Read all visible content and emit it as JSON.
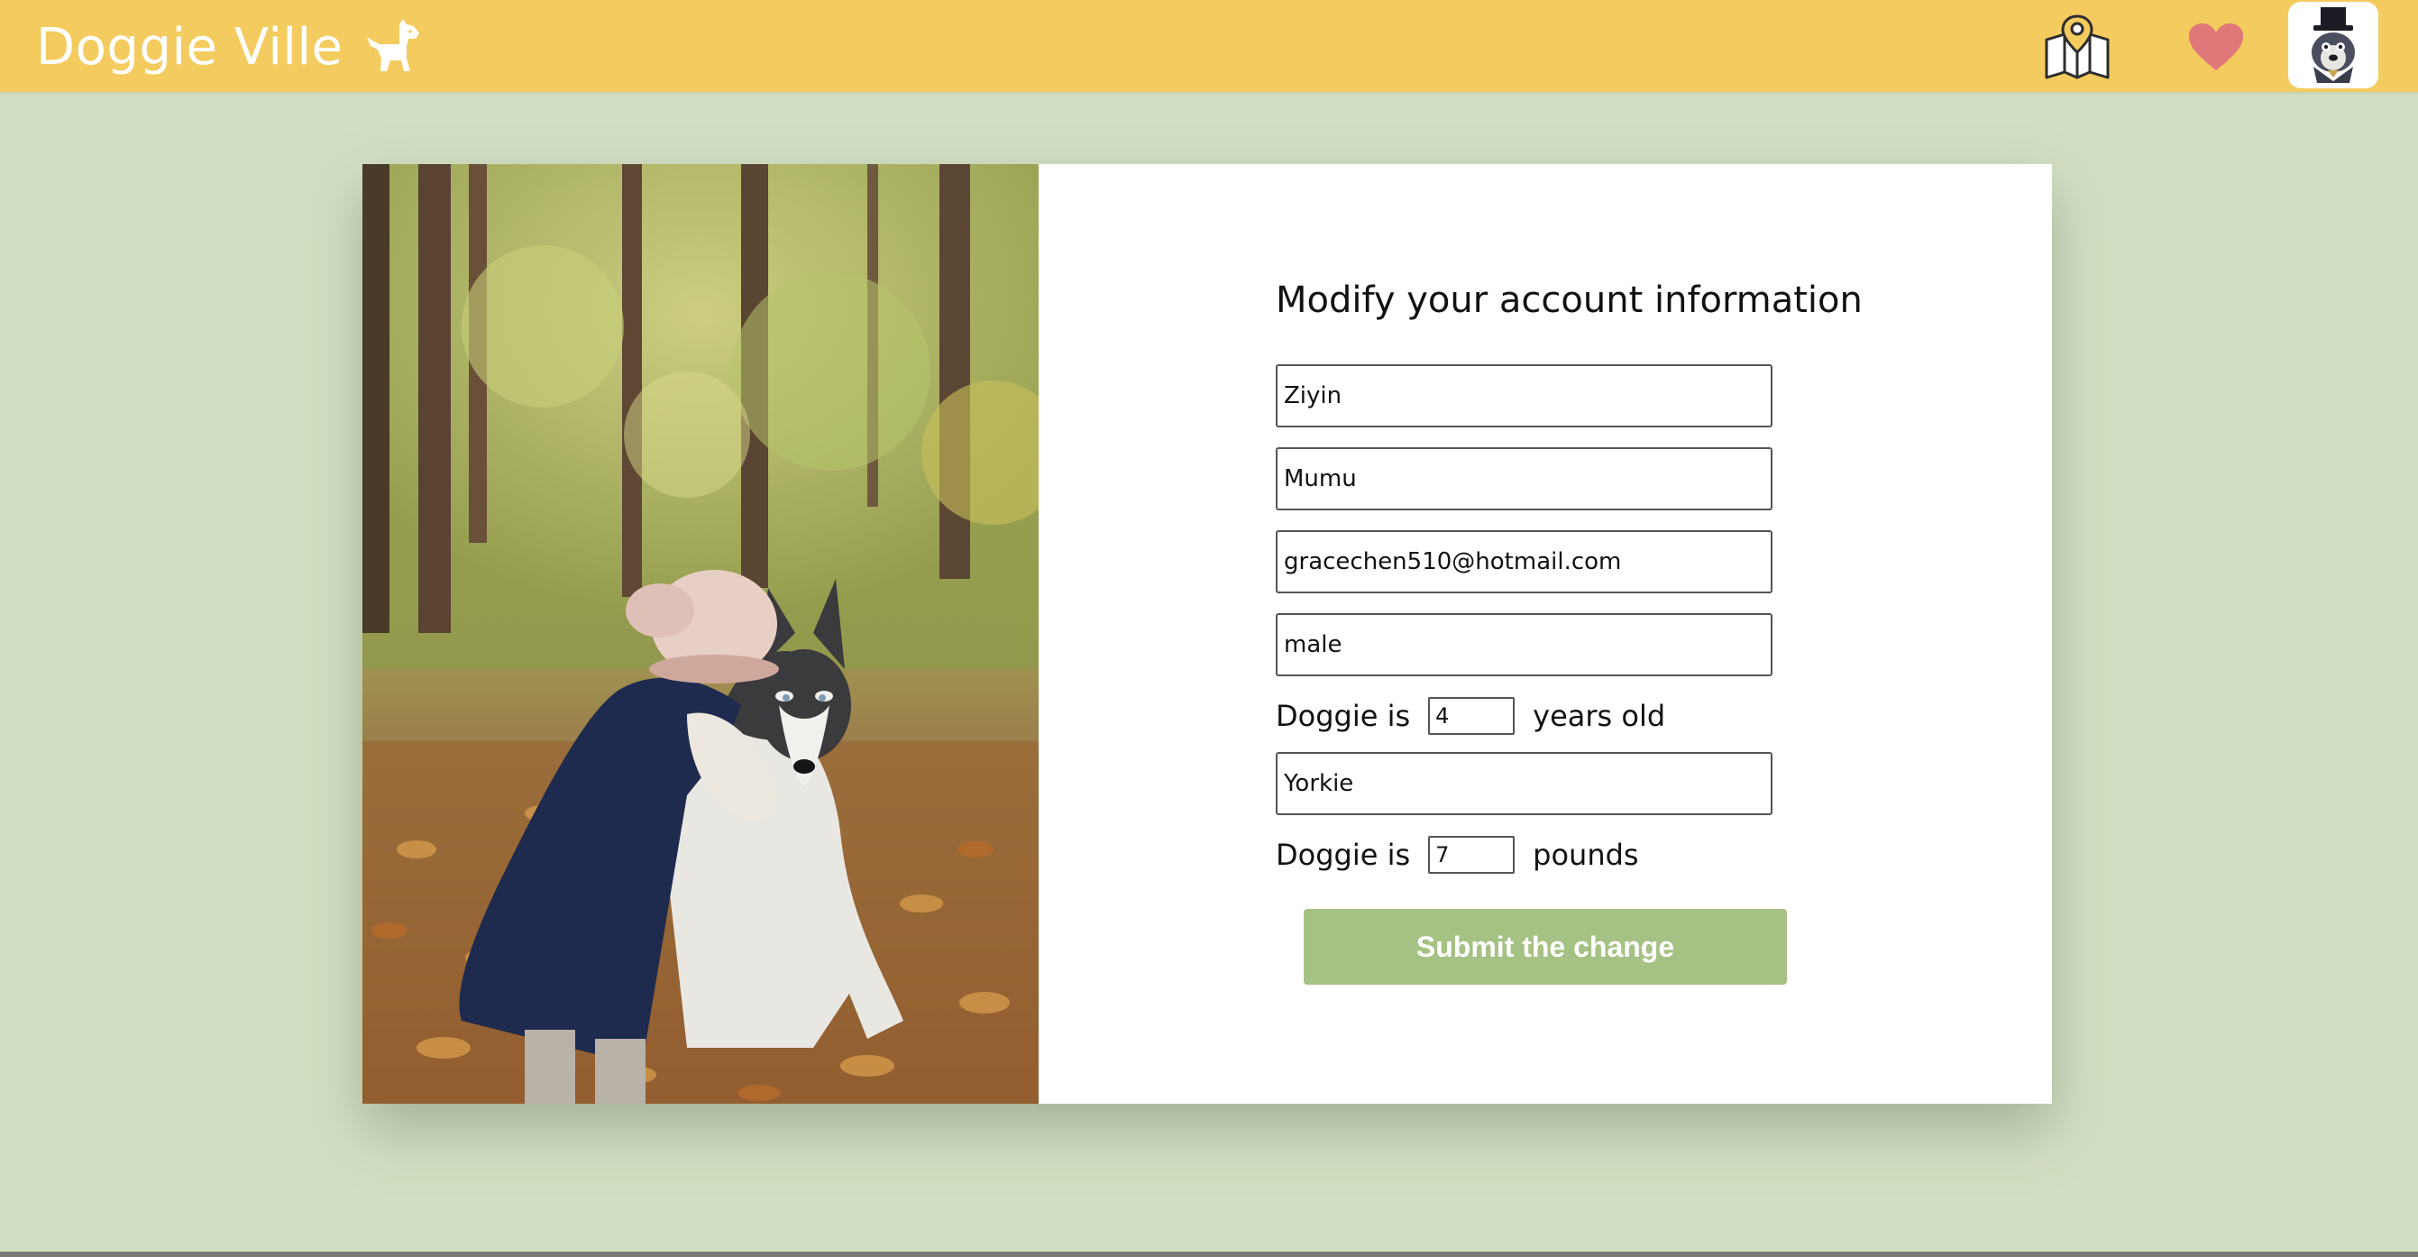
{
  "header": {
    "title": "Doggie Ville",
    "logo_icon": "dog-icon",
    "nav": [
      {
        "name": "map",
        "icon": "map-pin-icon"
      },
      {
        "name": "favorites",
        "icon": "heart-icon"
      },
      {
        "name": "profile",
        "icon": "avatar-icon"
      }
    ],
    "colors": {
      "bar": "#f4cb5e",
      "heart": "#e0787a"
    }
  },
  "page": {
    "background": "#d3dfc2"
  },
  "form": {
    "title": "Modify your account information",
    "first_name": "Ziyin",
    "dog_name": "Mumu",
    "email": "gracechen510@hotmail.com",
    "gender": "male",
    "age_prefix": "Doggie is",
    "age_value": "4",
    "age_suffix": "years old",
    "breed": "Yorkie",
    "weight_prefix": "Doggie is",
    "weight_value": "7",
    "weight_suffix": "pounds",
    "submit_label": "Submit the change",
    "submit_color": "#a5c184"
  }
}
